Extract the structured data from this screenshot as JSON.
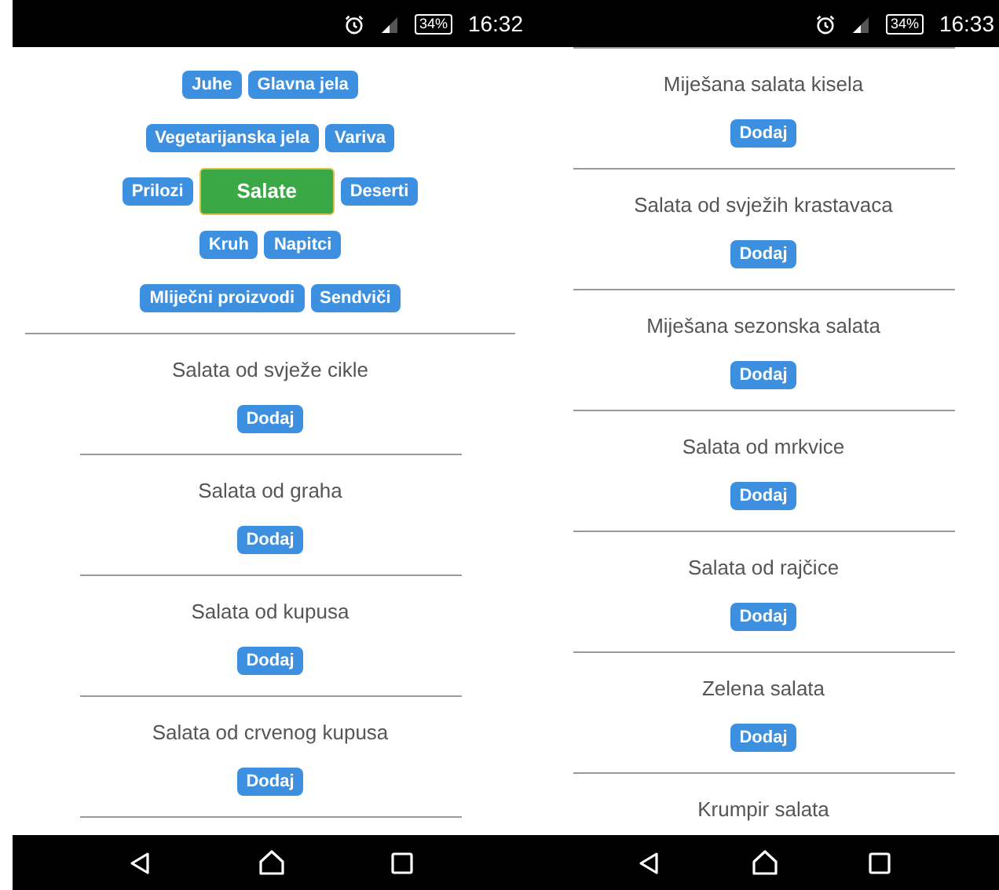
{
  "phones": [
    {
      "status_bar": {
        "battery": "34%",
        "time": "16:32"
      },
      "category_rows": [
        [
          {
            "label": "Juhe",
            "selected": false
          },
          {
            "label": "Glavna jela",
            "selected": false
          }
        ],
        [
          {
            "label": "Vegetarijanska jela",
            "selected": false
          },
          {
            "label": "Variva",
            "selected": false
          }
        ],
        [
          {
            "label": "Prilozi",
            "selected": false
          },
          {
            "label": "Salate",
            "selected": true
          },
          {
            "label": "Deserti",
            "selected": false
          }
        ],
        [
          {
            "label": "Kruh",
            "selected": false
          },
          {
            "label": "Napitci",
            "selected": false
          }
        ],
        [
          {
            "label": "Mliječni proizvodi",
            "selected": false
          },
          {
            "label": "Sendviči",
            "selected": false
          }
        ]
      ],
      "items": [
        {
          "name": "Salata od svježe cikle",
          "button": "Dodaj"
        },
        {
          "name": "Salata od graha",
          "button": "Dodaj"
        },
        {
          "name": "Salata od kupusa",
          "button": "Dodaj"
        },
        {
          "name": "Salata od crvenog kupusa",
          "button": "Dodaj"
        }
      ]
    },
    {
      "status_bar": {
        "battery": "34%",
        "time": "16:33"
      },
      "items": [
        {
          "name": "Miješana salata kisela",
          "button": "Dodaj"
        },
        {
          "name": "Salata od svježih krastavaca",
          "button": "Dodaj"
        },
        {
          "name": "Miješana sezonska salata",
          "button": "Dodaj"
        },
        {
          "name": "Salata od mrkvice",
          "button": "Dodaj"
        },
        {
          "name": "Salata od rajčice",
          "button": "Dodaj"
        },
        {
          "name": "Zelena salata",
          "button": "Dodaj"
        },
        {
          "name": "Krumpir salata"
        }
      ]
    }
  ]
}
